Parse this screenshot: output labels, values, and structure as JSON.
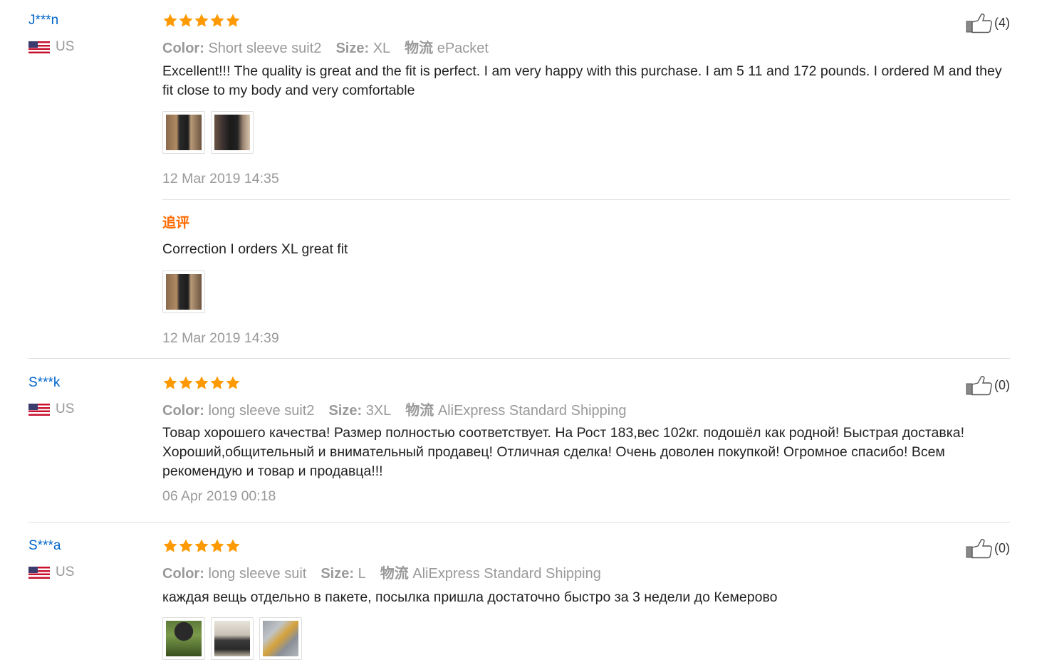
{
  "colors": {
    "star": "#ff9900",
    "link": "#0066cc",
    "followup_label": "#ff6a00"
  },
  "reviews": [
    {
      "user": "J***n",
      "country": "US",
      "rating": 5,
      "likes": "(4)",
      "color_label": "Color:",
      "color_value": "Short sleeve suit2",
      "size_label": "Size:",
      "size_value": "XL",
      "logistics_label": "物流",
      "logistics_value": "ePacket",
      "text": "Excellent!!! The quality is great and the fit is perfect. I am very happy with this purchase. I am 5 11 and 172 pounds. I ordered M and they fit close to my body and very comfortable",
      "photos": [
        "photo-1",
        "photo-2"
      ],
      "date": "12 Mar 2019 14:35",
      "followup": {
        "label": "追评",
        "text": "Correction I orders XL great fit",
        "photos": [
          "photo-1"
        ],
        "date": "12 Mar 2019 14:39"
      }
    },
    {
      "user": "S***k",
      "country": "US",
      "rating": 5,
      "likes": "(0)",
      "color_label": "Color:",
      "color_value": "long sleeve suit2",
      "size_label": "Size:",
      "size_value": "3XL",
      "logistics_label": "物流",
      "logistics_value": "AliExpress Standard Shipping",
      "text": "Товар хорошего качества! Размер полностью соответствует. На Рост 183,вес 102кг. подошёл как родной! Быстрая доставка! Хороший,общительный и внимательный продавец! Отличная сделка! Очень доволен покупкой! Огромное спасибо! Всем рекомендую и товар и продавца!!!",
      "date": "06 Apr 2019 00:18"
    },
    {
      "user": "S***a",
      "country": "US",
      "rating": 5,
      "likes": "(0)",
      "color_label": "Color:",
      "color_value": "long sleeve suit",
      "size_label": "Size:",
      "size_value": "L",
      "logistics_label": "物流",
      "logistics_value": "AliExpress Standard Shipping",
      "text": "каждая вещь отдельно в пакете, посылка пришла достаточно быстро за 3 недели до Кемерово",
      "photos": [
        "photo-1",
        "photo-2",
        "photo-3"
      ]
    }
  ]
}
